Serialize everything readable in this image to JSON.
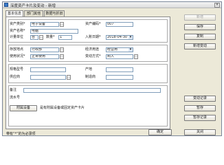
{
  "window": {
    "title": "深度资产卡片及变动 - 新增",
    "close_glyph": "×"
  },
  "tabs": [
    "基本信息",
    "部门其他",
    "数据与折旧"
  ],
  "form": {
    "asset_class_label": "资产类别*",
    "asset_class_value": "电子设备",
    "asset_code_label": "资产编码*",
    "asset_code_value": "007",
    "asset_name_label": "资产名称*",
    "asset_name_value": "电脑",
    "unit_label": "计量单位",
    "unit_value": "台",
    "qty_label": "数量*",
    "qty_value": "1",
    "entry_date_label": "入账日期*",
    "entry_date_value": "2018-04-30",
    "storage_label": "存放地点",
    "storage_value": "行政部",
    "acq_method_label": "经济用途",
    "acq_method_value": "经营用",
    "status_label": "使用状况*",
    "status_value": "正常使用",
    "change_method_label": "变动方式*",
    "change_method_value": "购入",
    "spec_label": "规格型号",
    "origin_label": "产地",
    "supplier_label": "供应商",
    "maker_label": "制造商",
    "remark_label": "备注",
    "serial_label": "流水号",
    "attach_button": "附属设备",
    "attach_checkbox": "是有附属设备或固定资产卡片"
  },
  "buttons": {
    "new": "新增",
    "save": "保存",
    "copy": "复制",
    "new_change": "新增变动",
    "change_record": "变动记录",
    "prev": "暂存",
    "cancel": "暂存记录",
    "ok": "确定",
    "close": "关闭"
  },
  "footer_note": "带有“*”的为必录项"
}
